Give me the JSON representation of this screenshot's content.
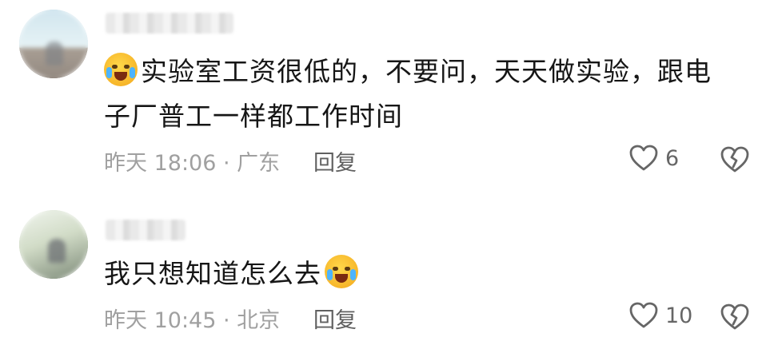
{
  "comments": [
    {
      "text_line1": "实验室工资很低的，不要问，天天做实验，跟电",
      "text_line2": "子厂普工一样都工作时间",
      "emoji": "crying-face-icon",
      "meta": "昨天 18:06 · 广东",
      "reply_label": "回复",
      "likes": "6"
    },
    {
      "text": "我只想知道怎么去",
      "emoji": "sob-face-icon",
      "meta": "昨天 10:45 · 北京",
      "reply_label": "回复",
      "likes": "10"
    }
  ],
  "colors": {
    "text": "#161616",
    "meta": "#a0a0a0",
    "reply": "#606060",
    "icon": "#666666"
  }
}
